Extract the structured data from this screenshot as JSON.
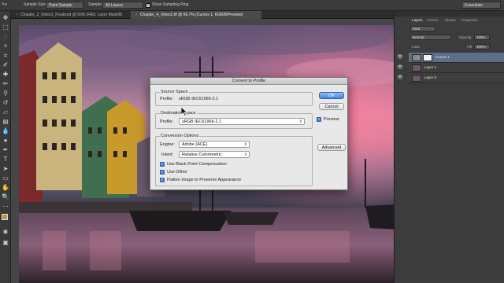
{
  "options_bar": {
    "sample_size_label": "Sample Size:",
    "sample_size_value": "Point Sample",
    "sample_label": "Sample:",
    "sample_value": "All Layers",
    "show_ring_label": "Show Sampling Ring",
    "workspace": "Essentials"
  },
  "tabs": [
    {
      "label": "Chapter_2_Video1_Finalized @ 50% (FAD, Layer Mask/8)"
    },
    {
      "label": "Chapter_4_Video2.tif @ 66.7% (Curves 1, RGB/8/Preview)"
    }
  ],
  "panel": {
    "tabs": [
      "Layers",
      "Actions",
      "History",
      "Properties"
    ],
    "kind": "Kind",
    "blend_mode": "Normal",
    "opacity_label": "Opacity:",
    "opacity_value": "100%",
    "lock_label": "Lock:",
    "fill_label": "Fill:",
    "fill_value": "100%",
    "layers": [
      {
        "name": "Curves 1"
      },
      {
        "name": "Layer 1"
      },
      {
        "name": "Layer 0"
      }
    ]
  },
  "dialog": {
    "title": "Convert to Profile",
    "source_space": {
      "title": "Source Space",
      "profile_label": "Profile:",
      "profile_value": "sRGB IEC61966-2.1"
    },
    "destination_space": {
      "title": "Destination Space",
      "profile_label": "Profile:",
      "profile_value": "sRGB IEC61966-2.1"
    },
    "conversion_options": {
      "title": "Conversion Options",
      "engine_label": "Engine:",
      "engine_value": "Adobe (ACE)",
      "intent_label": "Intent:",
      "intent_value": "Relative Colorimetric",
      "checkboxes": [
        {
          "label": "Use Black Point Compensation",
          "checked": true
        },
        {
          "label": "Use Dither",
          "checked": true
        },
        {
          "label": "Flatten Image to Preserve Appearance",
          "checked": true
        }
      ]
    },
    "buttons": {
      "ok": "OK",
      "cancel": "Cancel",
      "advanced": "Advanced"
    },
    "preview_label": "Preview",
    "preview_checked": true
  },
  "colors": {
    "accent": "#3f86df",
    "selected_layer": "#5b6e8a",
    "foreground_swatch": "#b89a45"
  }
}
